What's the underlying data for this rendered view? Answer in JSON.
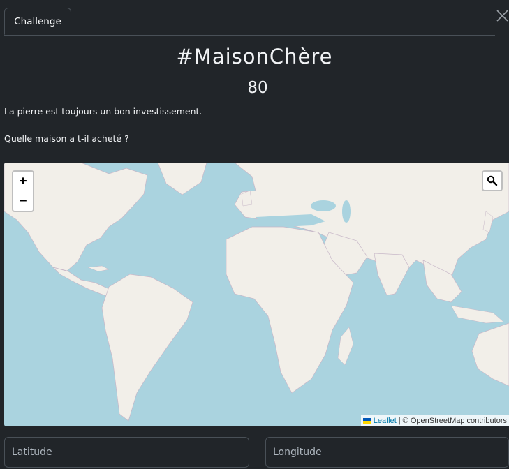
{
  "tabs": [
    {
      "label": "Challenge"
    }
  ],
  "title": "#MaisonChère",
  "score": "80",
  "description": "La pierre est toujours un bon investissement.",
  "question": "Quelle maison a t-il acheté ?",
  "map": {
    "zoom_in": "+",
    "zoom_out": "−",
    "attribution": {
      "link": "Leaflet",
      "separator": "|",
      "text": "© OpenStreetMap contributors"
    },
    "colors": {
      "water": "#aad3df",
      "land": "#f2efe9"
    }
  },
  "inputs": {
    "latitude": {
      "placeholder": "Latitude",
      "value": ""
    },
    "longitude": {
      "placeholder": "Longitude",
      "value": ""
    }
  }
}
